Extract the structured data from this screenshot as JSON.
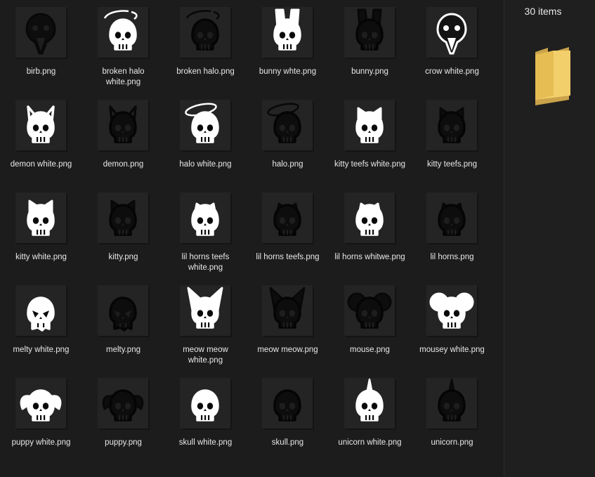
{
  "details": {
    "item_count": "30 items",
    "preview_icon": "folder-icon"
  },
  "files": [
    {
      "label": "birb.png",
      "icon": "birb",
      "white": false
    },
    {
      "label": "broken halo white.png",
      "icon": "broken-halo",
      "white": true
    },
    {
      "label": "broken halo.png",
      "icon": "broken-halo",
      "white": false
    },
    {
      "label": "bunny whte.png",
      "icon": "bunny",
      "white": true
    },
    {
      "label": "bunny.png",
      "icon": "bunny",
      "white": false
    },
    {
      "label": "crow white.png",
      "icon": "birb",
      "white": true
    },
    {
      "label": "demon white.png",
      "icon": "demon",
      "white": true
    },
    {
      "label": "demon.png",
      "icon": "demon",
      "white": false
    },
    {
      "label": "halo white.png",
      "icon": "halo",
      "white": true
    },
    {
      "label": "halo.png",
      "icon": "halo",
      "white": false
    },
    {
      "label": "kitty teefs white.png",
      "icon": "kitty-teefs",
      "white": true
    },
    {
      "label": "kitty teefs.png",
      "icon": "kitty-teefs",
      "white": false
    },
    {
      "label": "kitty white.png",
      "icon": "kitty",
      "white": true
    },
    {
      "label": "kitty.png",
      "icon": "kitty",
      "white": false
    },
    {
      "label": "lil horns teefs white.png",
      "icon": "lil-horns",
      "white": true
    },
    {
      "label": "lil horns teefs.png",
      "icon": "lil-horns",
      "white": false
    },
    {
      "label": "lil horns whitwe.png",
      "icon": "lil-horns",
      "white": true
    },
    {
      "label": "lil horns.png",
      "icon": "lil-horns",
      "white": false
    },
    {
      "label": "melty white.png",
      "icon": "melty",
      "white": true
    },
    {
      "label": "melty.png",
      "icon": "melty",
      "white": false
    },
    {
      "label": "meow meow white.png",
      "icon": "meow",
      "white": true
    },
    {
      "label": "meow meow.png",
      "icon": "meow",
      "white": false
    },
    {
      "label": "mouse.png",
      "icon": "mouse",
      "white": false
    },
    {
      "label": "mousey white.png",
      "icon": "mouse",
      "white": true
    },
    {
      "label": "puppy white.png",
      "icon": "puppy",
      "white": true
    },
    {
      "label": "puppy.png",
      "icon": "puppy",
      "white": false
    },
    {
      "label": "skull white.png",
      "icon": "skull",
      "white": true
    },
    {
      "label": "skull.png",
      "icon": "skull",
      "white": false
    },
    {
      "label": "unicorn white.png",
      "icon": "unicorn",
      "white": true
    },
    {
      "label": "unicorn.png",
      "icon": "unicorn",
      "white": false
    }
  ]
}
